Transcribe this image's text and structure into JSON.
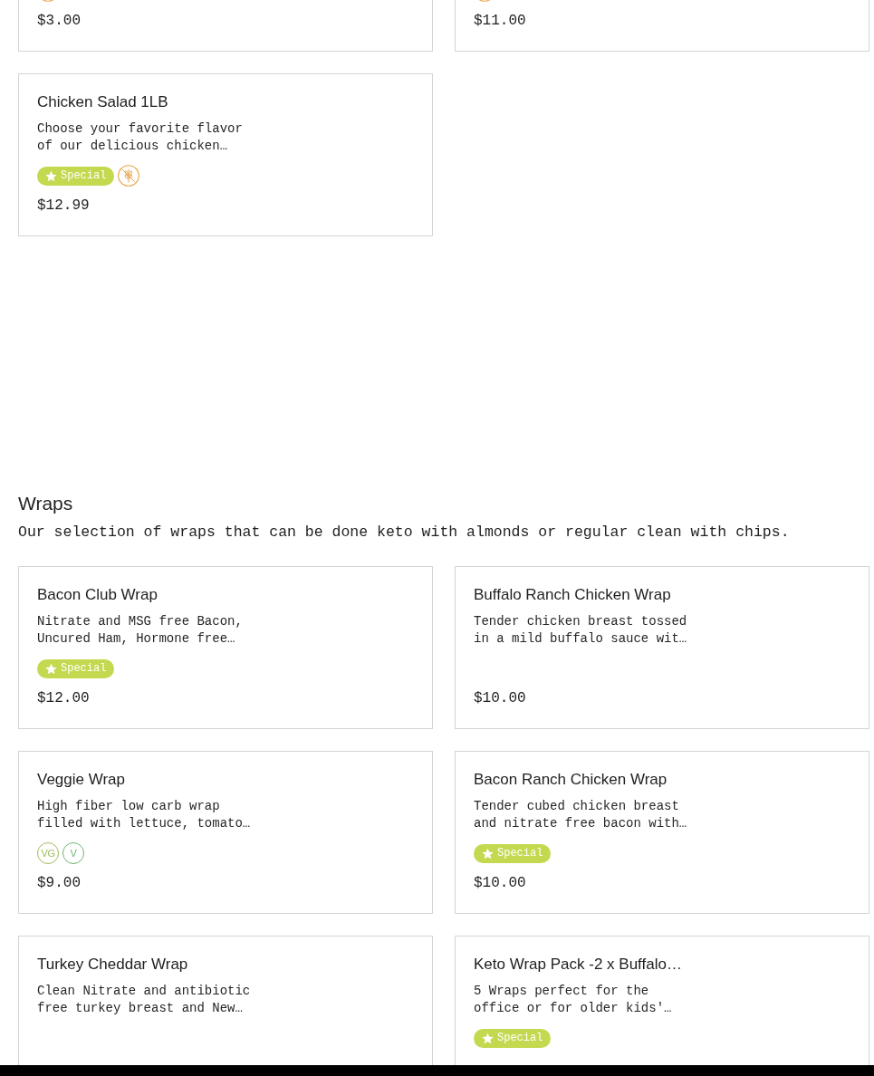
{
  "sections": [
    {
      "items": [
        {
          "tags": [
            {
              "kind": "gluten_free"
            }
          ],
          "price": "$3.00"
        },
        {
          "tags": [
            {
              "kind": "gluten_free"
            }
          ],
          "price": "$11.00"
        },
        {
          "name": "Chicken Salad 1LB",
          "description": "Choose your favorite flavor of our delicious chicken…",
          "tags": [
            {
              "kind": "special",
              "label": "Special"
            },
            {
              "kind": "gluten_free"
            }
          ],
          "price": "$12.99"
        }
      ]
    },
    {
      "title": "Wraps",
      "description": "Our selection of wraps that can be done keto with almonds or regular clean with chips.",
      "items": [
        {
          "name": "Bacon Club Wrap",
          "description": "Nitrate and MSG free Bacon, Uncured Ham, Hormone free…",
          "tags": [
            {
              "kind": "special",
              "label": "Special"
            }
          ],
          "price": "$12.00"
        },
        {
          "name": "Buffalo Ranch Chicken Wrap",
          "description": "Tender chicken breast tossed in a mild buffalo sauce wit…",
          "price": "$10.00"
        },
        {
          "name": "Veggie Wrap",
          "description": "High fiber low carb wrap filled with lettuce, tomato…",
          "tags": [
            {
              "kind": "vegan",
              "label": "VG"
            },
            {
              "kind": "vegetarian",
              "label": "V"
            }
          ],
          "price": "$9.00"
        },
        {
          "name": "Bacon Ranch Chicken Wrap",
          "description": "Tender cubed chicken breast and nitrate free bacon with…",
          "tags": [
            {
              "kind": "special",
              "label": "Special"
            }
          ],
          "price": "$10.00"
        },
        {
          "name": "Turkey Cheddar Wrap",
          "description": "Clean Nitrate and antibiotic free turkey breast and New…"
        },
        {
          "name": "Keto Wrap Pack -2 x Buffalo…",
          "description": "5 Wraps perfect for the office or for older kids'…",
          "tags": [
            {
              "kind": "special",
              "label": "Special"
            }
          ]
        }
      ]
    }
  ]
}
